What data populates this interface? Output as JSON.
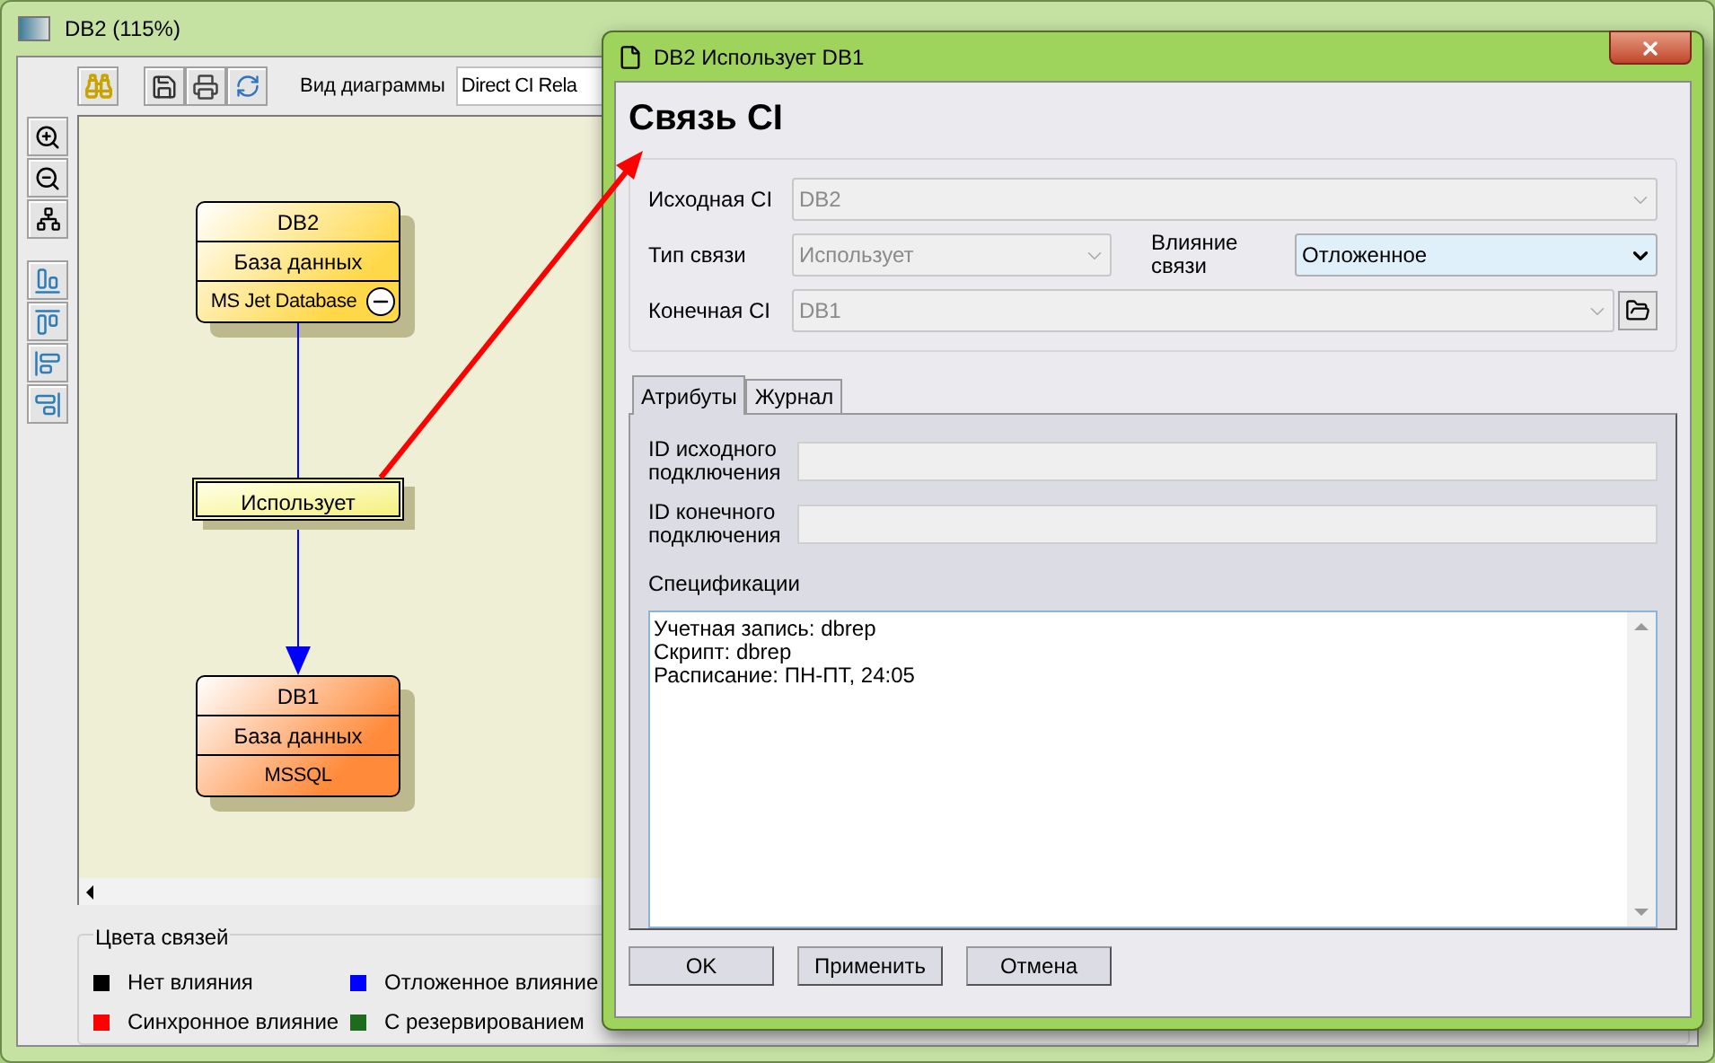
{
  "window": {
    "title": "DB2 (115%)"
  },
  "toolbar": {
    "view_label": "Вид диаграммы",
    "view_value": "Direct CI Rela"
  },
  "diagram": {
    "nodes": [
      {
        "name": "DB2",
        "type": "База данных",
        "product": "MS Jet Database",
        "color": "#ffd84a",
        "collapsible": true
      },
      {
        "name": "DB1",
        "type": "База данных",
        "product": "MSSQL",
        "color": "#ff8a3a",
        "collapsible": false
      }
    ],
    "link": {
      "label": "Использует",
      "color": "#0000ff",
      "selected": true
    }
  },
  "legend": {
    "title": "Цвета связей",
    "items": [
      {
        "label": "Нет влияния",
        "color": "#000000"
      },
      {
        "label": "Отложенное влияние",
        "color": "#0000ff"
      },
      {
        "label": "Синхронное влияние",
        "color": "#ff0000"
      },
      {
        "label": "С резервированием",
        "color": "#1e6b1e"
      }
    ]
  },
  "dialog": {
    "title": "DB2 Использует DB1",
    "heading": "Связь CI",
    "source": {
      "label": "Исходная CI",
      "value": "DB2",
      "disabled": true
    },
    "link_type": {
      "label": "Тип связи",
      "value": "Использует",
      "disabled": true
    },
    "impact": {
      "label": "Влияние связи",
      "value": "Отложенное",
      "disabled": false
    },
    "target": {
      "label": "Конечная CI",
      "value": "DB1",
      "disabled": true
    },
    "tabs": [
      {
        "label": "Атрибуты",
        "selected": true
      },
      {
        "label": "Журнал",
        "selected": false
      }
    ],
    "source_id": {
      "label": "ID исходного подключения"
    },
    "target_id": {
      "label": "ID конечного подключения"
    },
    "specs": {
      "label": "Спецификации",
      "lines": [
        "Учетная запись: dbrep",
        "Скрипт: dbrep",
        "Расписание: ПН-ПТ, 24:05"
      ]
    },
    "buttons": [
      "OK",
      "Применить",
      "Отмена"
    ]
  }
}
